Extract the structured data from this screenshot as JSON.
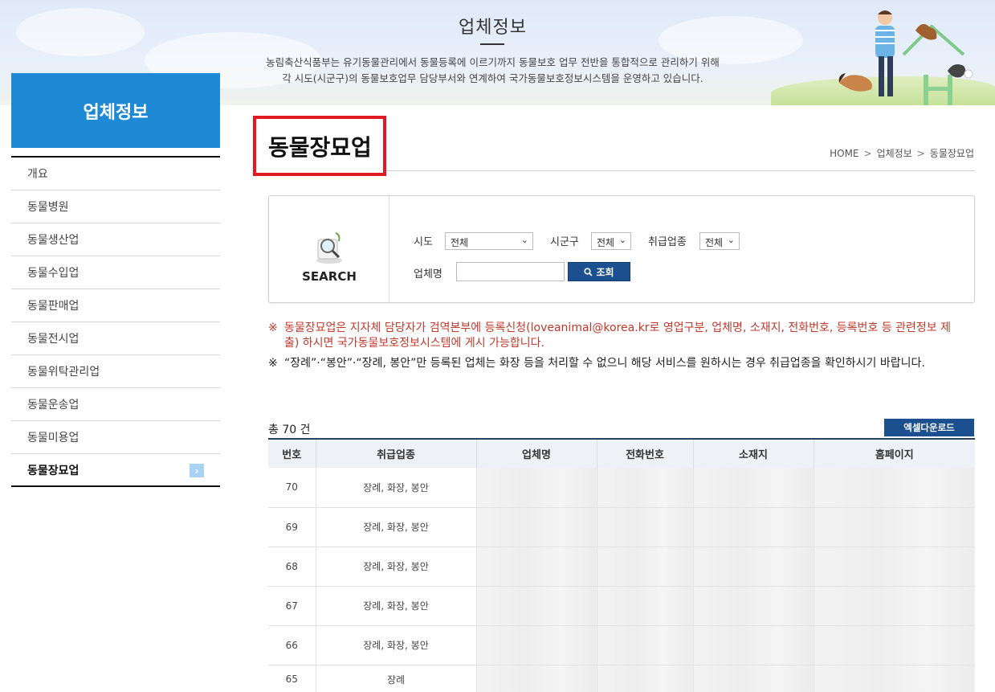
{
  "banner": {
    "title": "업체정보",
    "desc_line1": "농림축산식품부는 유기동물관리에서 동물등록에 이르기까지 동물보호 업무 전반을 통합적으로 관리하기 위해",
    "desc_line2": "각 시도(시군구)의 동물보호업무 담당부서와 연계하여 국가동물보호정보시스템을 운영하고 있습니다."
  },
  "sidebar": {
    "title": "업체정보",
    "items": [
      {
        "label": "개요"
      },
      {
        "label": "동물병원"
      },
      {
        "label": "동물생산업"
      },
      {
        "label": "동물수입업"
      },
      {
        "label": "동물판매업"
      },
      {
        "label": "동물전시업"
      },
      {
        "label": "동물위탁관리업"
      },
      {
        "label": "동물운송업"
      },
      {
        "label": "동물미용업"
      },
      {
        "label": "동물장묘업"
      }
    ],
    "active_index": 9
  },
  "main": {
    "page_title": "동물장묘업",
    "breadcrumb": [
      "HOME",
      "업체정보",
      "동물장묘업"
    ]
  },
  "search": {
    "label": "SEARCH",
    "sido_label": "시도",
    "sido_value": "전체",
    "sigungu_label": "시군구",
    "sigungu_value": "전체",
    "biz_type_label": "취급업종",
    "biz_type_value": "전체",
    "company_label": "업체명",
    "company_value": "",
    "search_button": "조회"
  },
  "notices": {
    "mark": "※",
    "red_text": "동물장묘업은 지자체 담당자가 검역본부에 등록신청(loveanimal@korea.kr로 영업구분, 업체명, 소재지, 전화번호, 등록번호 등 관련정보 제출) 하시면 국가동물보호정보시스템에 게시 가능합니다.",
    "dark_text": "“장례”·“봉안”·“장례, 봉안”만 등록된 업체는 화장 등을 처리할 수 없으니 해당 서비스를 원하시는 경우 취급업종을 확인하시기 바랍니다."
  },
  "results": {
    "count_text": "총 70 건",
    "excel_button": "엑셀다운로드",
    "columns": [
      "번호",
      "취급업종",
      "업체명",
      "전화번호",
      "소재지",
      "홈페이지"
    ],
    "rows": [
      {
        "no": "70",
        "type": "장례, 화장, 봉안"
      },
      {
        "no": "69",
        "type": "장례, 화장, 봉안"
      },
      {
        "no": "68",
        "type": "장례, 화장, 봉안"
      },
      {
        "no": "67",
        "type": "장례, 화장, 봉안"
      },
      {
        "no": "66",
        "type": "장례, 화장, 봉안"
      },
      {
        "no": "65",
        "type": "장례"
      }
    ]
  },
  "colors": {
    "accent_blue": "#1e8ad6",
    "button_navy": "#1c4f8f",
    "highlight_red": "#e01a22",
    "notice_red": "#c0392b"
  }
}
